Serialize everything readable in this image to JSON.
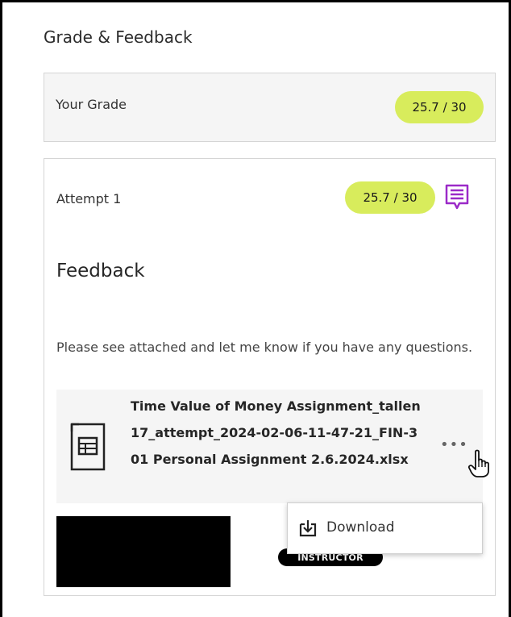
{
  "panel": {
    "title": "Grade & Feedback"
  },
  "your_grade": {
    "label": "Your Grade",
    "score": "25.7 / 30"
  },
  "attempt": {
    "label": "Attempt 1",
    "score": "25.7 / 30",
    "feedback_icon": "feedback-comment-icon"
  },
  "feedback": {
    "heading": "Feedback",
    "text": "Please see attached and let me know if you have any questions.",
    "attachment": {
      "icon": "spreadsheet-file-icon",
      "filename": "Time Value of Money Assignment_tallen17_attempt_2024-02-06-11-47-21_FIN-301 Personal Assignment 2.6.2024.xlsx",
      "more_label": "•••"
    }
  },
  "context_menu": {
    "items": [
      {
        "label": "Download",
        "icon": "download-icon"
      }
    ]
  },
  "author": {
    "role": "INSTRUCTOR"
  },
  "colors": {
    "grade_pill": "#d8ec5c",
    "feedback_icon": "#9b2ac8",
    "border": "#d5d5d5",
    "panel_bg": "#f5f5f5"
  }
}
